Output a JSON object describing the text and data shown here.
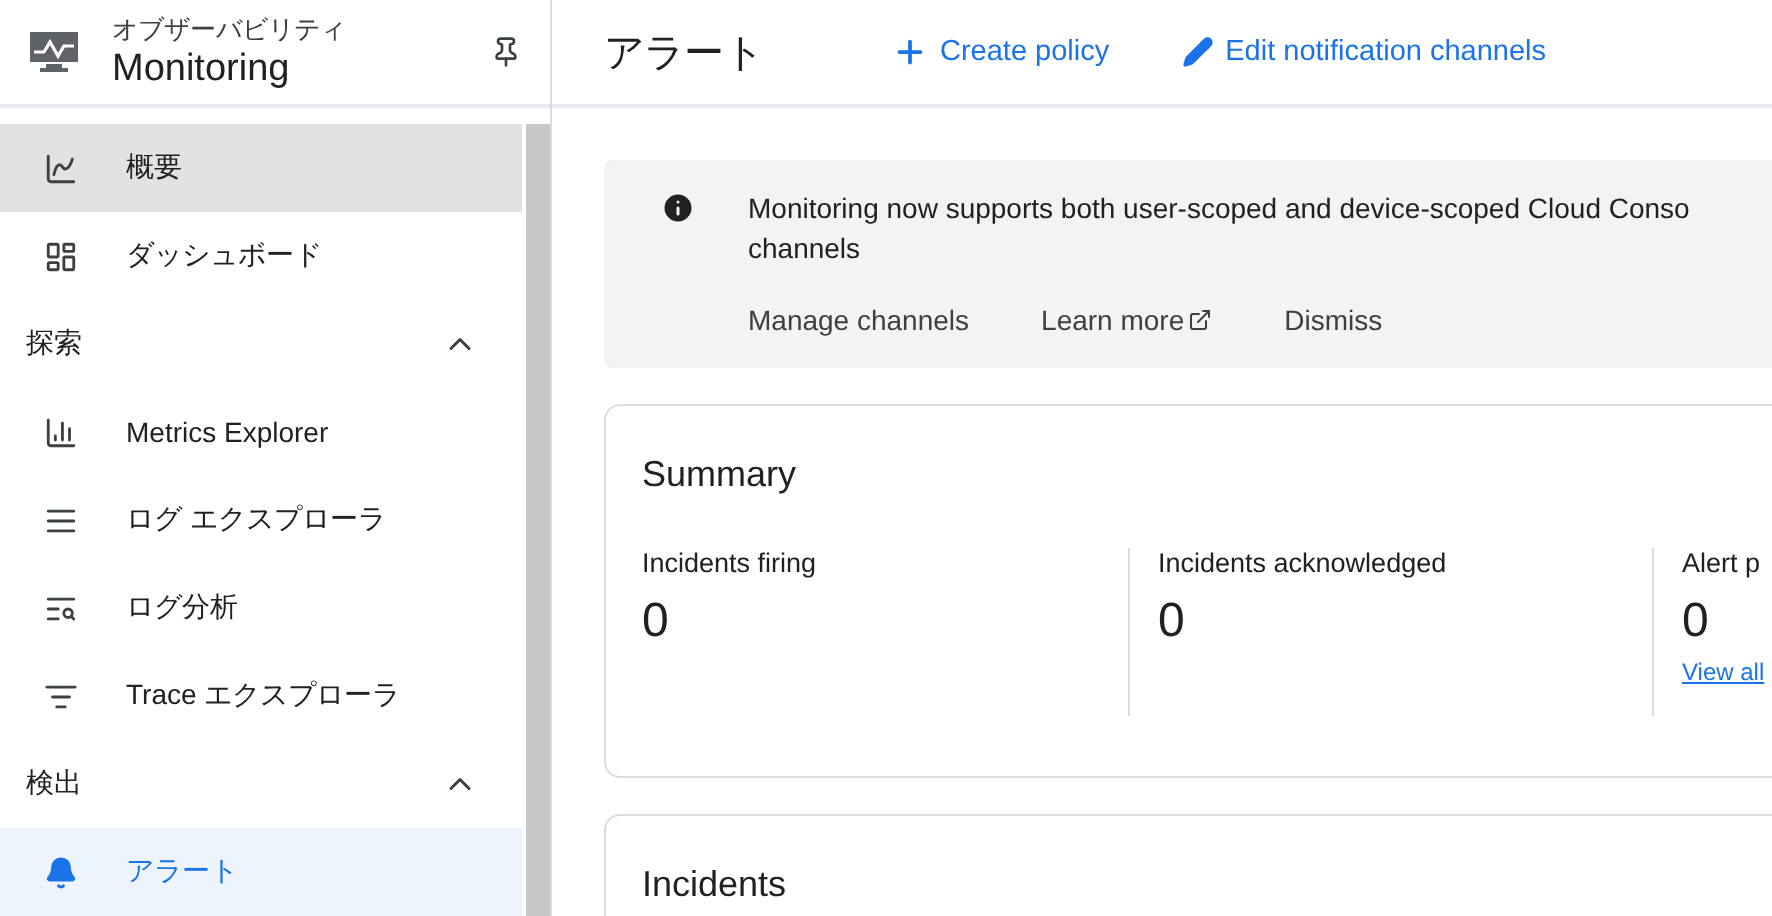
{
  "product": {
    "subtitle": "オブザーバビリティ",
    "title": "Monitoring"
  },
  "sidebar": {
    "items": [
      {
        "kind": "item",
        "label": "概要",
        "selected": false,
        "hovered": true
      },
      {
        "kind": "item",
        "label": "ダッシュボード",
        "selected": false,
        "hovered": false
      },
      {
        "kind": "section",
        "label": "探索",
        "expanded": true
      },
      {
        "kind": "item",
        "label": "Metrics Explorer",
        "selected": false,
        "hovered": false
      },
      {
        "kind": "item",
        "label": "ログ エクスプローラ",
        "selected": false,
        "hovered": false
      },
      {
        "kind": "item",
        "label": "ログ分析",
        "selected": false,
        "hovered": false
      },
      {
        "kind": "item",
        "label": "Trace エクスプローラ",
        "selected": false,
        "hovered": false
      },
      {
        "kind": "section",
        "label": "検出",
        "expanded": true
      },
      {
        "kind": "item",
        "label": "アラート",
        "selected": true,
        "hovered": false
      }
    ]
  },
  "header": {
    "title": "アラート",
    "actions": [
      {
        "label": "Create policy"
      },
      {
        "label": "Edit notification channels"
      }
    ]
  },
  "banner": {
    "lines": [
      "Monitoring now supports both user-scoped and device-scoped Cloud Conso",
      "channels"
    ],
    "actions": [
      {
        "label": "Manage channels",
        "external": false
      },
      {
        "label": "Learn more",
        "external": true
      },
      {
        "label": "Dismiss",
        "external": false
      }
    ]
  },
  "summary": {
    "title": "Summary",
    "stats": [
      {
        "label": "Incidents firing",
        "value": "0"
      },
      {
        "label": "Incidents acknowledged",
        "value": "0"
      },
      {
        "label": "Alert p",
        "value": "0",
        "link": "View all"
      }
    ]
  },
  "incidents": {
    "title": "Incidents"
  }
}
